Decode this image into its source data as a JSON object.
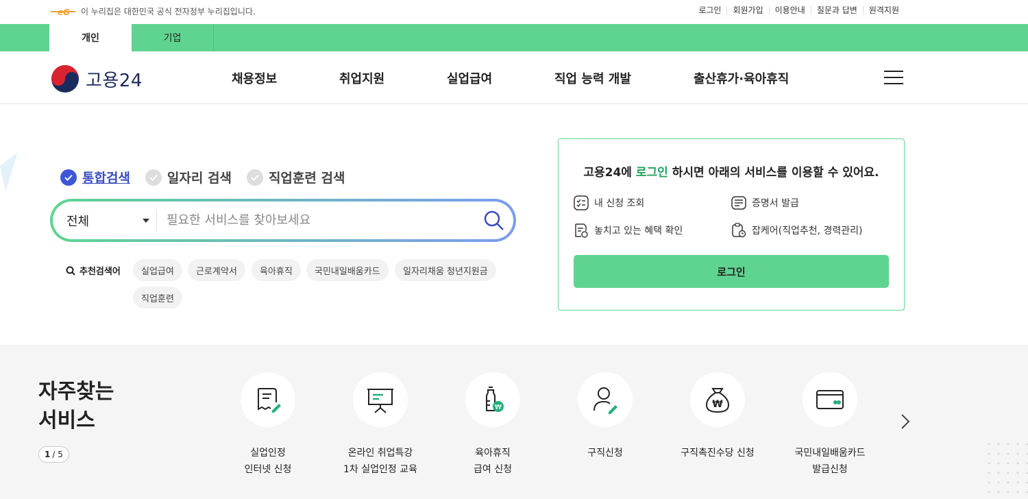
{
  "top_util": {
    "gov_notice": "이 누리집은 대한민국 공식 전자정부 누리집입니다.",
    "links": [
      "로그인",
      "회원가입",
      "이용안내",
      "질문과 답변",
      "원격지원"
    ]
  },
  "tabs": [
    "개인",
    "기업"
  ],
  "logo": {
    "text": "고용24"
  },
  "gnb": [
    "채용정보",
    "취업지원",
    "실업급여",
    "직업 능력 개발",
    "출산휴가·육아휴직"
  ],
  "search": {
    "types": [
      "통합검색",
      "일자리 검색",
      "직업훈련 검색"
    ],
    "scope": "전체",
    "placeholder": "필요한 서비스를 찾아보세요",
    "recommend_label": "추천검색어",
    "keywords": [
      "실업급여",
      "근로계약서",
      "육아휴직",
      "국민내일배움카드",
      "일자리채움 청년지원금",
      "직업훈련"
    ]
  },
  "login_card": {
    "title_pre": "고용24에 ",
    "title_hl": "로그인",
    "title_post": " 하시면 아래의 서비스를 이용할 수 있어요.",
    "services": [
      "내 신청 조회",
      "증명서 발급",
      "놓치고 있는 혜택 확인",
      "잡케어(직업추천, 경력관리)"
    ],
    "button": "로그인"
  },
  "frequent": {
    "title_line1": "자주찾는",
    "title_line2": "서비스",
    "page_current": "1",
    "page_total": "/ 5",
    "items": [
      {
        "line1": "실업인정",
        "line2": "인터넷 신청"
      },
      {
        "line1": "온라인 취업특강",
        "line2": "1차 실업인정 교육"
      },
      {
        "line1": "육아휴직",
        "line2": "급여 신청"
      },
      {
        "line1": "구직신청",
        "line2": ""
      },
      {
        "line1": "구직촉진수당 신청",
        "line2": ""
      },
      {
        "line1": "국민내일배움카드",
        "line2": "발급신청"
      }
    ]
  },
  "colors": {
    "brand_green": "#5fd491",
    "accent_blue": "#3c57d8"
  }
}
